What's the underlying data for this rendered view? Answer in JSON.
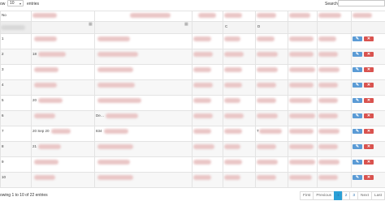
{
  "controls": {
    "show_label": "ow",
    "page_length": "10",
    "entries_label": "entries",
    "search_label": "Search:"
  },
  "columns": [
    "No",
    "",
    "",
    "",
    "",
    "",
    "",
    "",
    ""
  ],
  "filter_row": {
    "c0_icon": "calendar-icon",
    "c0_symbol": "                                                                                                                                                           ",
    "c1_label": "C",
    "c2_label": "D"
  },
  "rows": [
    {
      "no": "1",
      "date": "",
      "desc": "",
      "num": ""
    },
    {
      "no": "2",
      "date": "18",
      "desc": "",
      "num": ""
    },
    {
      "no": "3",
      "date": "",
      "desc": "",
      "num": ""
    },
    {
      "no": "4",
      "date": "",
      "desc": "",
      "num": ""
    },
    {
      "no": "5",
      "date": "20",
      "desc": "",
      "num": ""
    },
    {
      "no": "6",
      "date": "",
      "desc": "De…",
      "num": ""
    },
    {
      "no": "7",
      "date": "20 Sep 20",
      "desc": "834",
      "num": "T"
    },
    {
      "no": "8",
      "date": "21",
      "desc": "",
      "num": ""
    },
    {
      "no": "9",
      "date": "",
      "desc": "",
      "num": ""
    },
    {
      "no": "10",
      "date": "",
      "desc": "",
      "num": ""
    }
  ],
  "footer": {
    "info": "owing 1 to 10 of 22 entries",
    "pagination": [
      "First",
      "Previous",
      "1",
      "2",
      "3",
      "Next",
      "Last"
    ],
    "active_page": "1"
  },
  "colors": {
    "edit": "#5b9bd5",
    "delete": "#d9534f",
    "active_page": "#2a9fd6"
  }
}
